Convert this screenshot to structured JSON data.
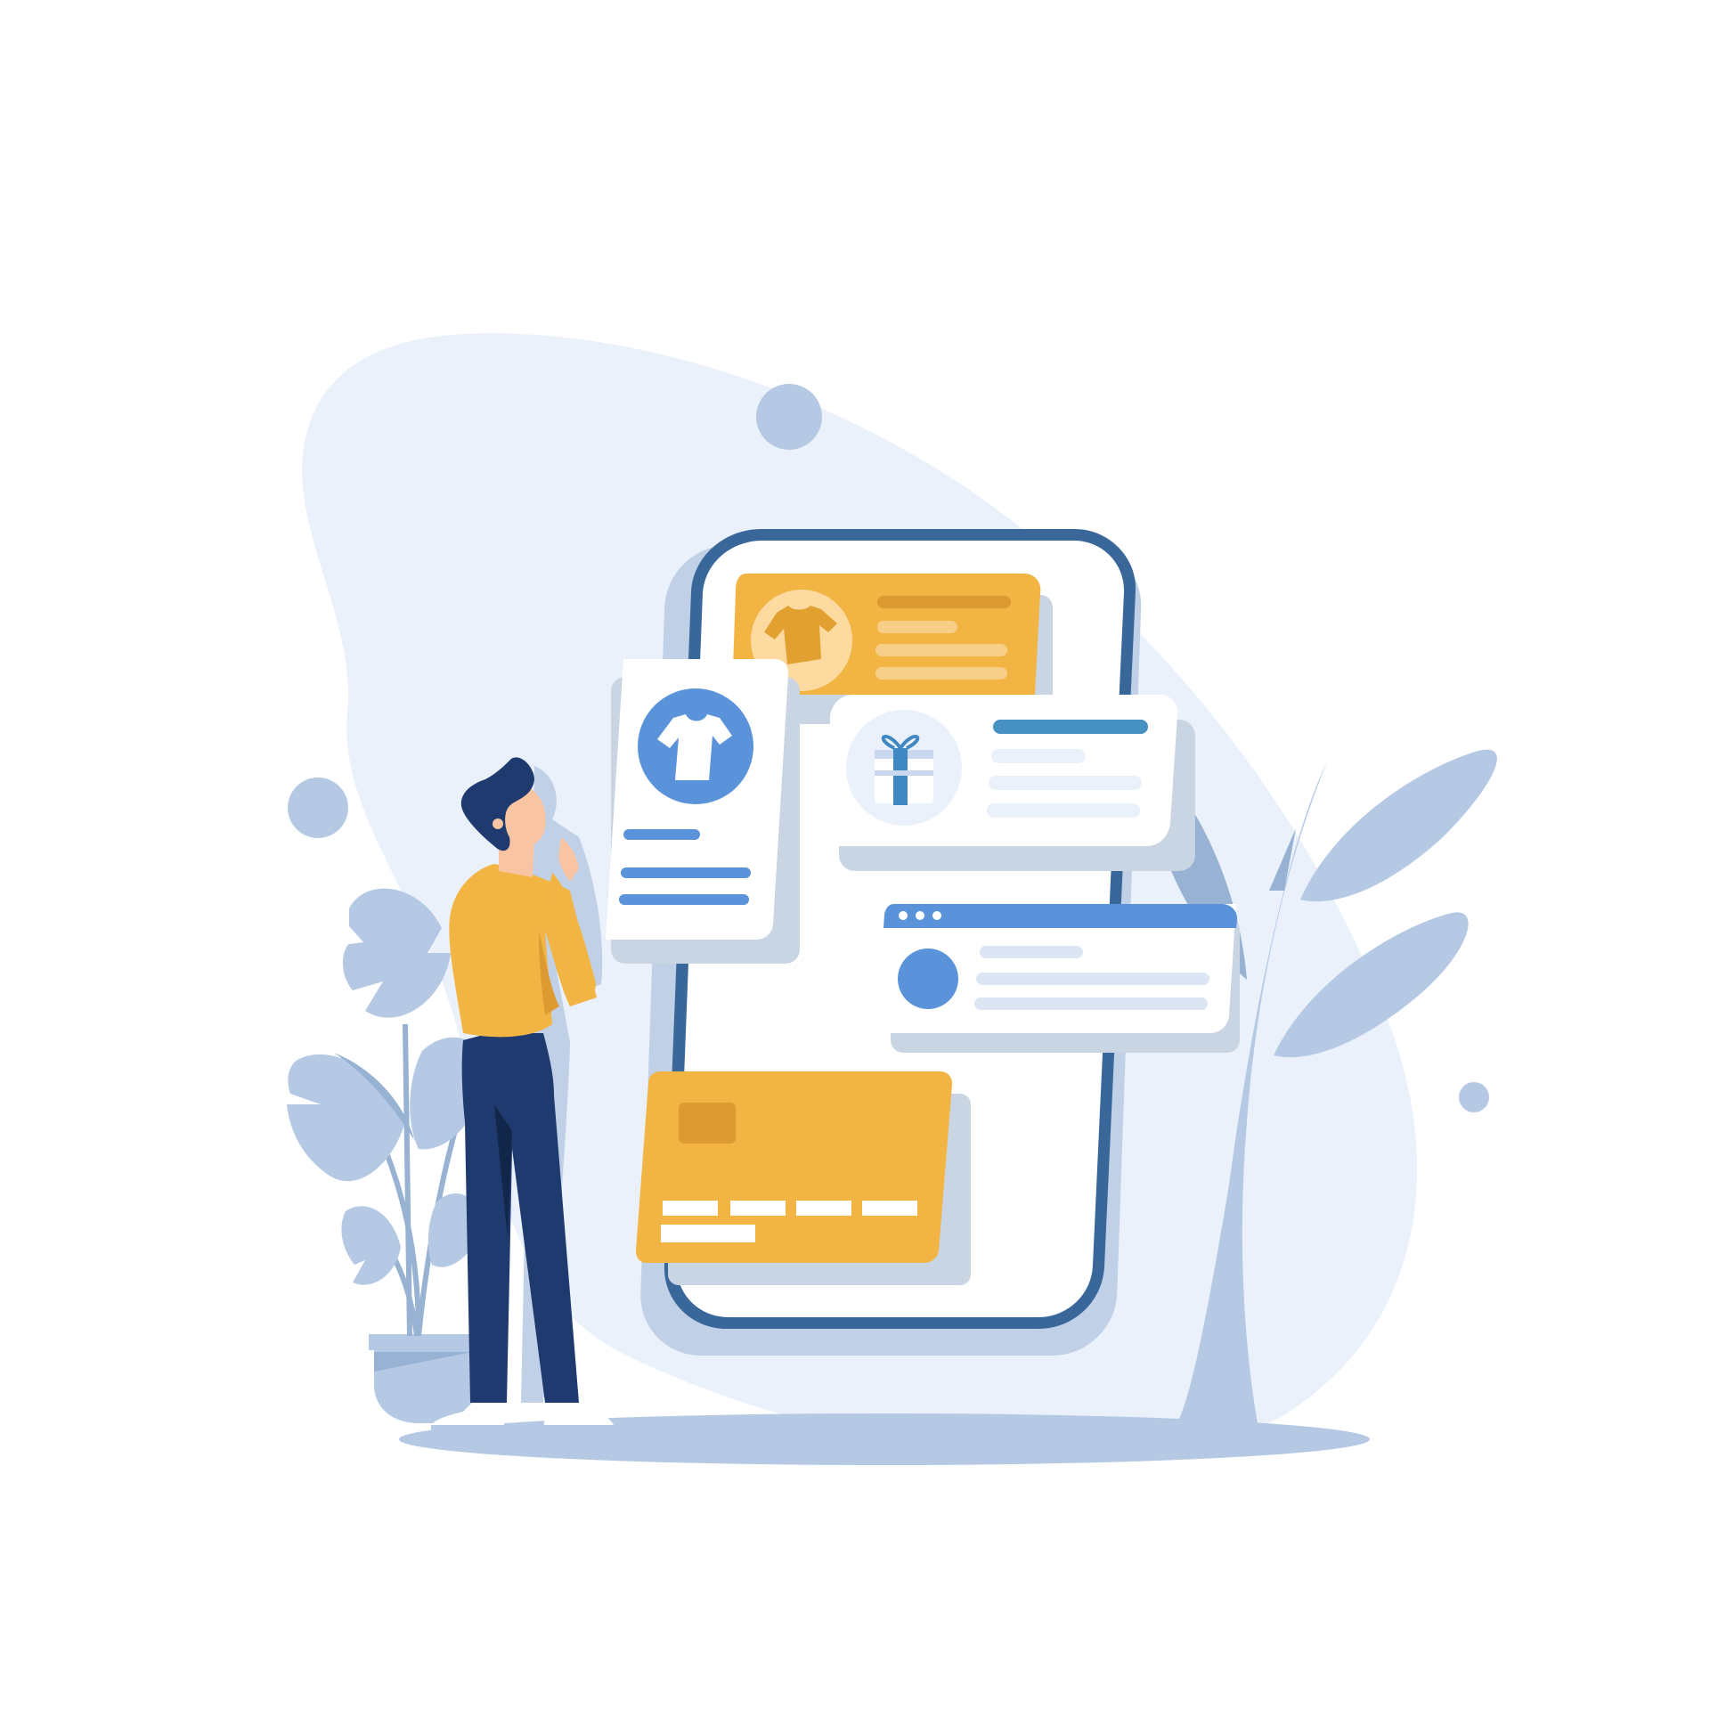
{
  "illustration": {
    "subject": "person-shopping-on-phone",
    "icons": [
      "tshirt-icon",
      "gift-icon",
      "credit-card-icon",
      "browser-dots-icon"
    ],
    "colors": {
      "background": "#ffffff",
      "blob": "#EBF1FB",
      "accent_yellow": "#F2B544",
      "accent_yellow_dark": "#DD9A30",
      "accent_blue": "#5A93DA",
      "navy": "#1F3A6E",
      "phone_outline": "#3A679A",
      "shadow": "#CAD5E3",
      "foliage": "#B5C9E5",
      "foliage_dark": "#97B2D3",
      "line_light": "#DCE5F3"
    }
  }
}
